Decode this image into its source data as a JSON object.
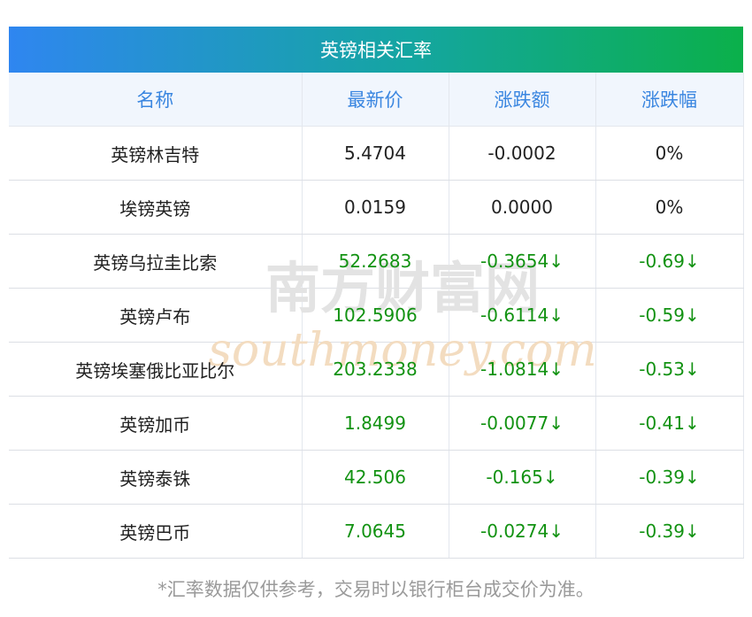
{
  "table_title": "英镑相关汇率",
  "columns": [
    "名称",
    "最新价",
    "涨跌额",
    "涨跌幅"
  ],
  "rows": [
    {
      "name": "英镑林吉特",
      "price": "5.4704",
      "change": "-0.0002",
      "percent": "0%",
      "direction": "flat"
    },
    {
      "name": "埃镑英镑",
      "price": "0.0159",
      "change": "0.0000",
      "percent": "0%",
      "direction": "flat"
    },
    {
      "name": "英镑乌拉圭比索",
      "price": "52.2683",
      "change": "-0.3654↓",
      "percent": "-0.69↓",
      "direction": "down"
    },
    {
      "name": "英镑卢布",
      "price": "102.5906",
      "change": "-0.6114↓",
      "percent": "-0.59↓",
      "direction": "down"
    },
    {
      "name": "英镑埃塞俄比亚比尔",
      "price": "203.2338",
      "change": "-1.0814↓",
      "percent": "-0.53↓",
      "direction": "down"
    },
    {
      "name": "英镑加币",
      "price": "1.8499",
      "change": "-0.0077↓",
      "percent": "-0.41↓",
      "direction": "down"
    },
    {
      "name": "英镑泰铢",
      "price": "42.506",
      "change": "-0.165↓",
      "percent": "-0.39↓",
      "direction": "down"
    },
    {
      "name": "英镑巴币",
      "price": "7.0645",
      "change": "-0.0274↓",
      "percent": "-0.39↓",
      "direction": "down"
    }
  ],
  "watermark": {
    "cn": "南方财富网",
    "en": "southmoney.com"
  },
  "footnote": "*汇率数据仅供参考，交易时以银行柜台成交价为准。",
  "colors": {
    "header_text": "#3a86e0",
    "down": "#129212",
    "title_gradient_start": "#2f86f0",
    "title_gradient_end": "#0bb04a"
  }
}
